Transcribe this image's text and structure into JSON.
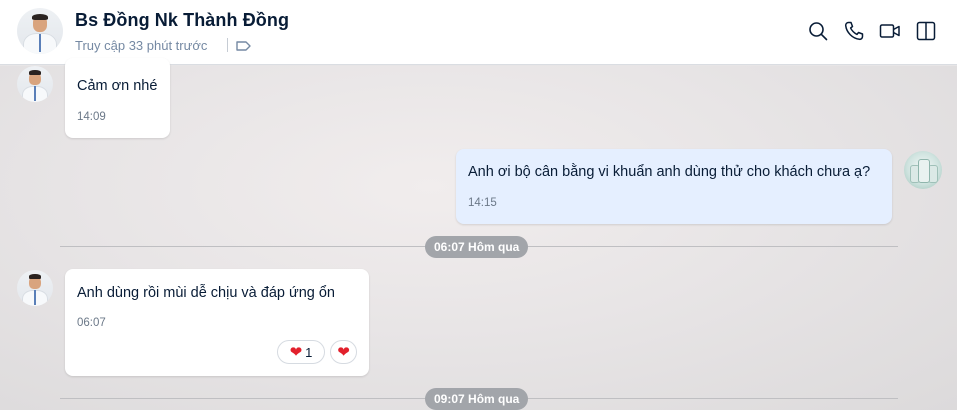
{
  "header": {
    "name": "Bs Đồng Nk Thành Đồng",
    "status": "Truy cập 33 phút trước",
    "icons": [
      "search-icon",
      "phone-icon",
      "video-icon",
      "side-panel-icon"
    ]
  },
  "messages": [
    {
      "sender": "contact",
      "text": "Cảm ơn nhé",
      "time": "14:09"
    },
    {
      "sender": "me",
      "text": "Anh ơi bộ cân bằng vi khuẩn anh dùng thử cho khách chưa ạ?",
      "time": "14:15"
    },
    {
      "sender": "contact",
      "text": "Anh dùng rồi mùi  dễ chịu  và  đáp ứng ổn",
      "time": "06:07",
      "reactions": {
        "heart_count": "1"
      }
    }
  ],
  "separators": [
    "06:07 Hôm qua",
    "09:07 Hôm qua"
  ],
  "colors": {
    "header_bg": "#ffffff",
    "chat_bg": "#e7e5e6",
    "my_bubble": "#e5efff",
    "their_bubble": "#ffffff",
    "separator_pill": "#a2a5aa",
    "reaction_heart": "#e2202c"
  }
}
